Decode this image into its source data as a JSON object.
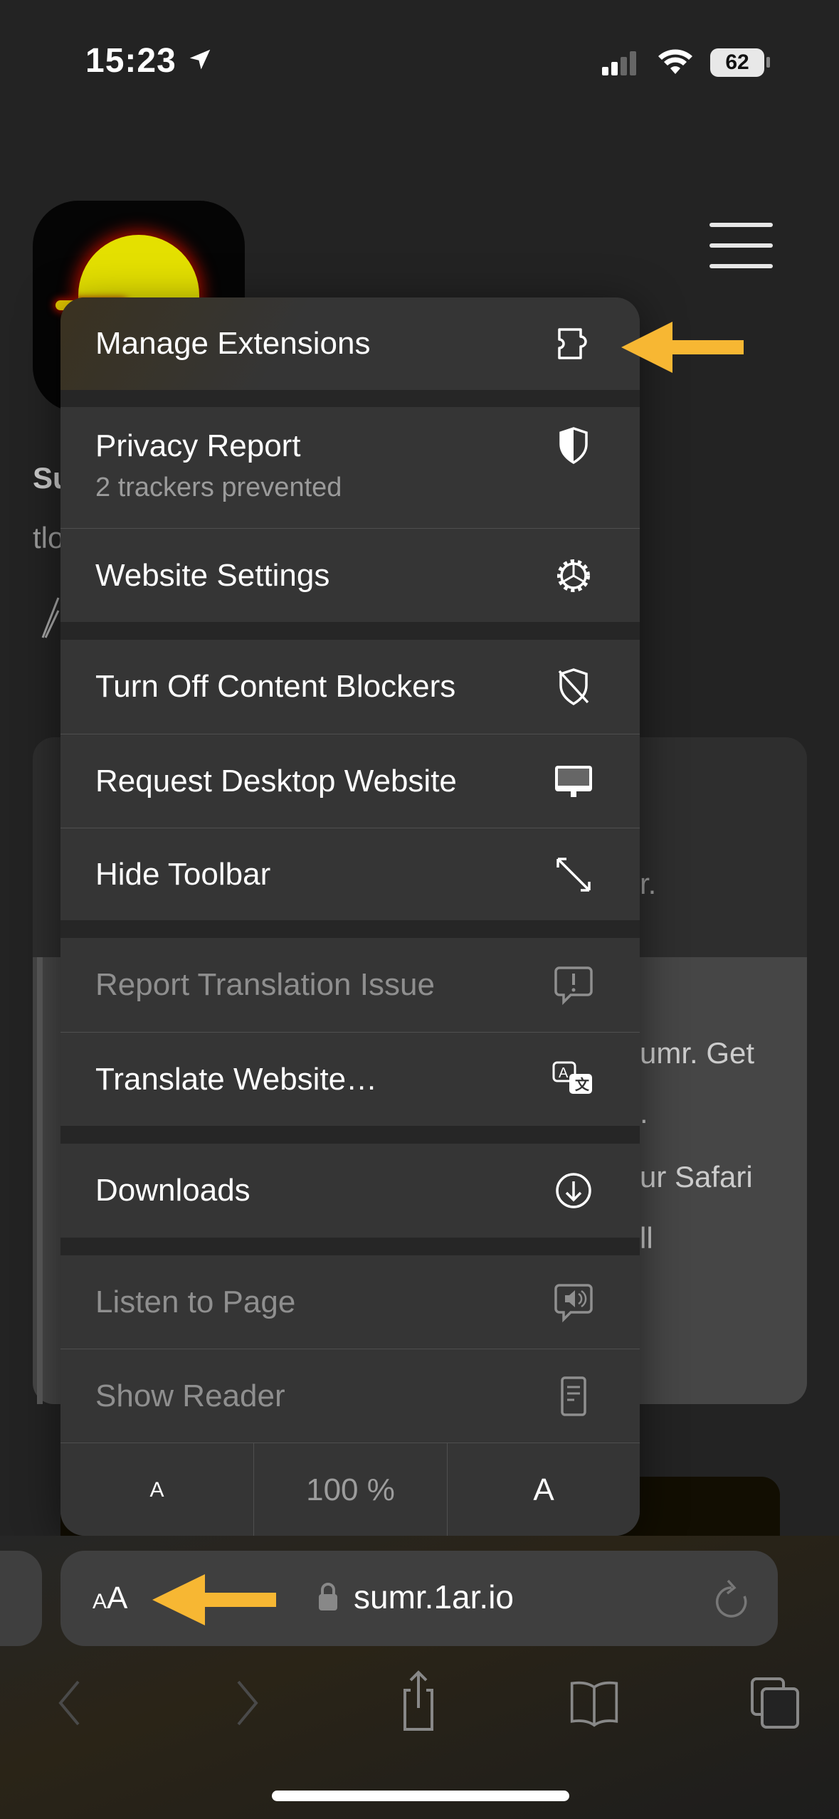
{
  "status_bar": {
    "time": "15:23",
    "battery": "62",
    "icons": [
      "location-arrow-icon",
      "cellular-signal-icon",
      "wifi-icon",
      "battery-icon"
    ]
  },
  "background_page": {
    "fragments": [
      "Su",
      "tlo",
      "r.",
      "umr. Get",
      ".",
      "ur Safari",
      "ll"
    ]
  },
  "menu": {
    "items": [
      {
        "label": "Manage Extensions",
        "icon": "puzzle-extension-icon",
        "enabled": true
      },
      {
        "label": "Privacy Report",
        "subtitle": "2 trackers prevented",
        "icon": "shield-icon",
        "enabled": true
      },
      {
        "label": "Website Settings",
        "icon": "gear-icon",
        "enabled": true
      },
      {
        "label": "Turn Off Content Blockers",
        "icon": "shield-slash-icon",
        "enabled": true
      },
      {
        "label": "Request Desktop Website",
        "icon": "desktop-icon",
        "enabled": true
      },
      {
        "label": "Hide Toolbar",
        "icon": "expand-arrows-icon",
        "enabled": true
      },
      {
        "label": "Report Translation Issue",
        "icon": "exclamation-bubble-icon",
        "enabled": false
      },
      {
        "label": "Translate Website…",
        "icon": "translate-icon",
        "enabled": true
      },
      {
        "label": "Downloads",
        "icon": "download-circle-icon",
        "enabled": true
      },
      {
        "label": "Listen to Page",
        "icon": "speaker-bubble-icon",
        "enabled": false
      },
      {
        "label": "Show Reader",
        "icon": "reader-icon",
        "enabled": false
      }
    ],
    "font_size": {
      "decrease": "A",
      "zoom": "100 %",
      "increase": "A"
    }
  },
  "address_bar": {
    "format_button": "AA",
    "url": "sumr.1ar.io"
  },
  "toolbar": {
    "icons": [
      "back-icon",
      "forward-icon",
      "share-icon",
      "bookmarks-icon",
      "tabs-icon"
    ]
  },
  "annotation_color": "#F7B733"
}
